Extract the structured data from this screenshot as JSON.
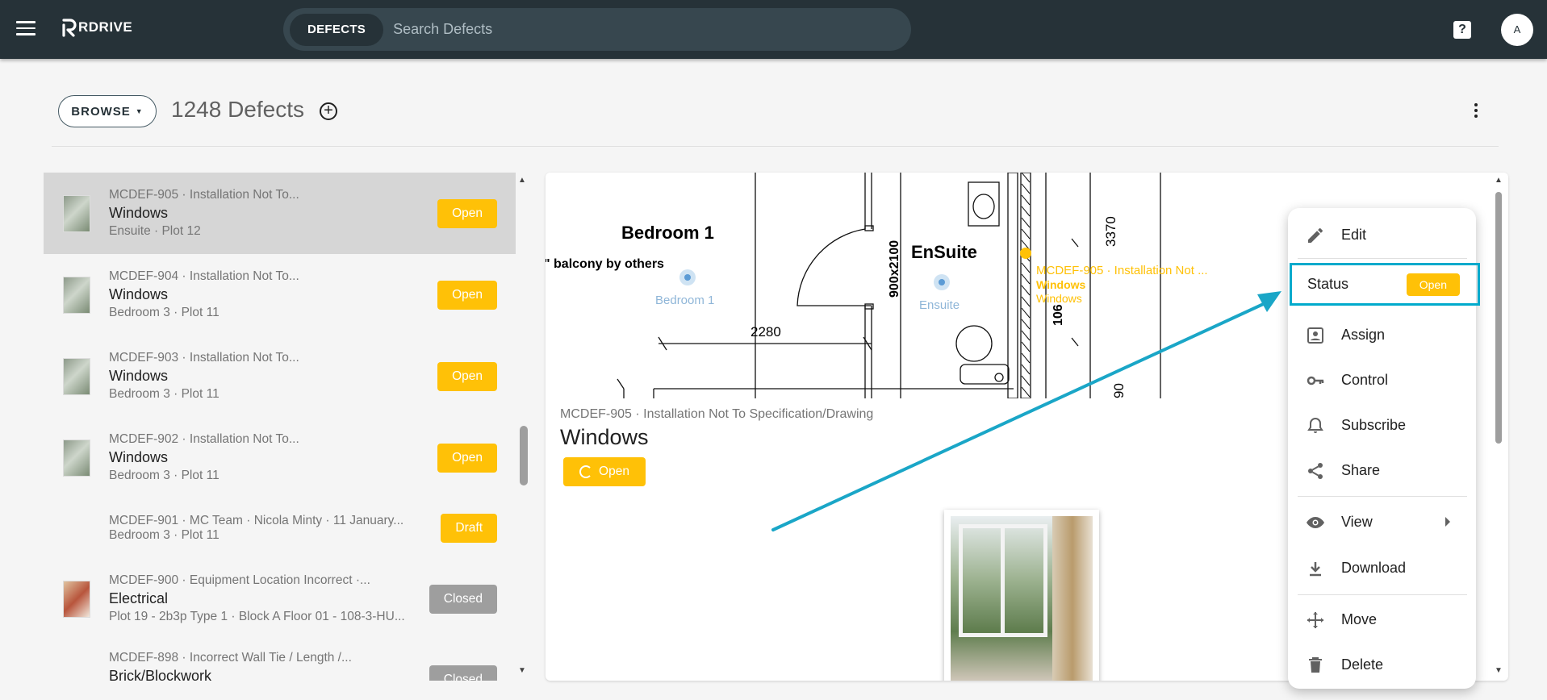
{
  "app": {
    "logo_text": "RDRIVE"
  },
  "search": {
    "chip_label": "DEFECTS",
    "placeholder": "Search Defects"
  },
  "header": {
    "avatar_initial": "A"
  },
  "toolbar": {
    "browse_label": "BROWSE",
    "count_label": "1248 Defects"
  },
  "list": {
    "items": [
      {
        "ref": "MCDEF-905 · Installation Not To...",
        "title": "Windows",
        "location": "Ensuite · Plot 12",
        "status": "Open"
      },
      {
        "ref": "MCDEF-904 · Installation Not To...",
        "title": "Windows",
        "location": "Bedroom 3 · Plot 11",
        "status": "Open"
      },
      {
        "ref": "MCDEF-903 · Installation Not To...",
        "title": "Windows",
        "location": "Bedroom 3 · Plot 11",
        "status": "Open"
      },
      {
        "ref": "MCDEF-902 · Installation Not To...",
        "title": "Windows",
        "location": "Bedroom 3 · Plot 11",
        "status": "Open"
      },
      {
        "ref": "MCDEF-901 · MC Team · Nicola Minty · 11 January...",
        "title": "",
        "location": "Bedroom 3 · Plot 11",
        "status": "Draft"
      },
      {
        "ref": "MCDEF-900 · Equipment Location Incorrect ·...",
        "title": "Electrical",
        "location": "Plot 19 - 2b3p Type 1 · Block A Floor 01 - 108-3-HU...",
        "status": "Closed"
      },
      {
        "ref": "MCDEF-898 · Incorrect Wall Tie / Length /...",
        "title": "Brick/Blockwork",
        "location": "",
        "status": "Closed"
      }
    ]
  },
  "plan": {
    "room_bedroom": "Bedroom 1",
    "room_ensuite": "EnSuite",
    "note_balcony": "\" balcony by others",
    "dim_2280": "2280",
    "dim_900x2100": "900x2100",
    "dim_3370": "3370",
    "dim_1060": "106",
    "dim_90": "90",
    "pin_bedroom": "Bedroom 1",
    "pin_ensuite": "Ensuite",
    "pin_defect_ref": "MCDEF-905 · Installation Not ...",
    "pin_defect_title": "Windows",
    "pin_defect_sub": "Windows"
  },
  "detail": {
    "ref": "MCDEF-905 · Installation Not To Specification/Drawing",
    "title": "Windows",
    "status": "Open"
  },
  "menu": {
    "edit": "Edit",
    "status_label": "Status",
    "status_value": "Open",
    "assign": "Assign",
    "control": "Control",
    "subscribe": "Subscribe",
    "share": "Share",
    "view": "View",
    "download": "Download",
    "move": "Move",
    "delete": "Delete"
  },
  "colors": {
    "topbar": "#263238",
    "accent_open": "#ffc107",
    "closed": "#9e9e9e",
    "highlight": "#00aacc"
  }
}
